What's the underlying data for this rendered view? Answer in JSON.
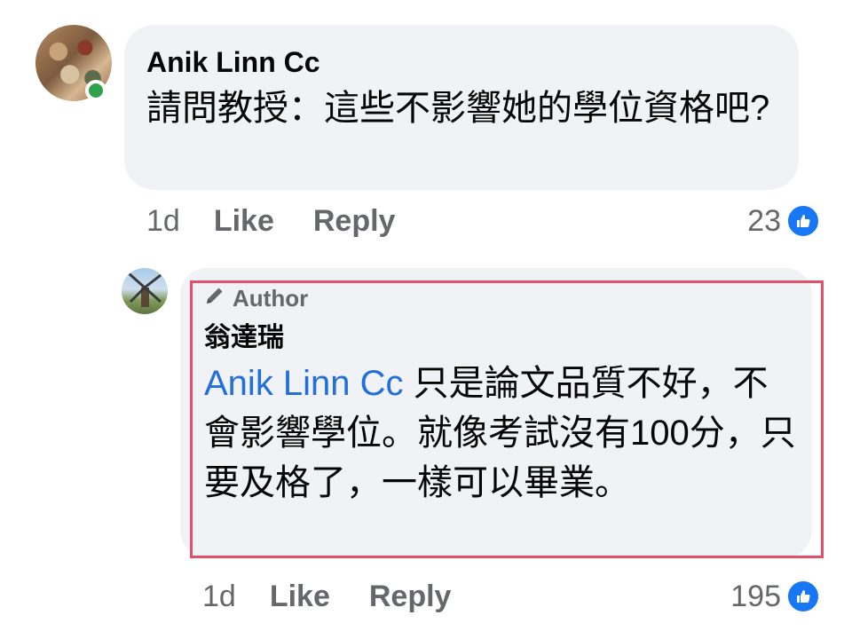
{
  "comment": {
    "author": "Anik Linn Cc",
    "text": "請問教授：這些不影響她的學位資格吧?",
    "time": "1d",
    "like_label": "Like",
    "reply_label": "Reply",
    "reaction_count": "23",
    "online": true
  },
  "reply": {
    "badge": "Author",
    "author": "翁達瑞",
    "mention": "Anik Linn Cc",
    "text": " 只是論文品質不好，不會影響學位。就像考試沒有100分，只要及格了，一樣可以畢業。",
    "time": "1d",
    "like_label": "Like",
    "reply_label": "Reply",
    "reaction_count": "195"
  },
  "colors": {
    "bubble": "#f0f2f5",
    "mention": "#216fdb",
    "highlight": "#e4506a",
    "like": "#1877f2",
    "online": "#31a24c",
    "muted": "#65676b"
  },
  "icons": {
    "pencil": "pencil-icon",
    "like": "like-thumb-icon"
  }
}
